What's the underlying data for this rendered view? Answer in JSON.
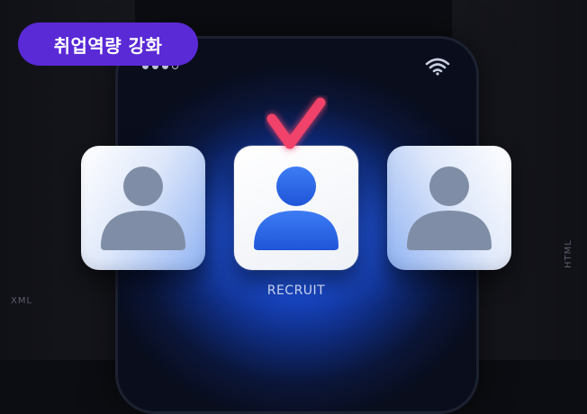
{
  "badge": {
    "text": "취업역량 강화"
  },
  "status_bar": {
    "signal_icon": "signal-dots-icon",
    "wifi_icon": "wifi-icon"
  },
  "cards": [
    {
      "role": "candidate",
      "icon": "person-icon",
      "color": "#7f8fa6",
      "selected": false
    },
    {
      "role": "selected-candidate",
      "icon": "person-icon",
      "color": "#2f6bf0",
      "selected": true
    },
    {
      "role": "candidate",
      "icon": "person-icon",
      "color": "#7f8fa6",
      "selected": false
    }
  ],
  "check_icon": {
    "name": "checkmark-icon",
    "color": "#f0436a"
  },
  "caption": "RECRUIT",
  "side_labels": {
    "left": "XML",
    "right": "HTML"
  },
  "colors": {
    "badge": "#5a2ad6",
    "glow": "#1f63ff",
    "accent_check": "#f0436a"
  }
}
